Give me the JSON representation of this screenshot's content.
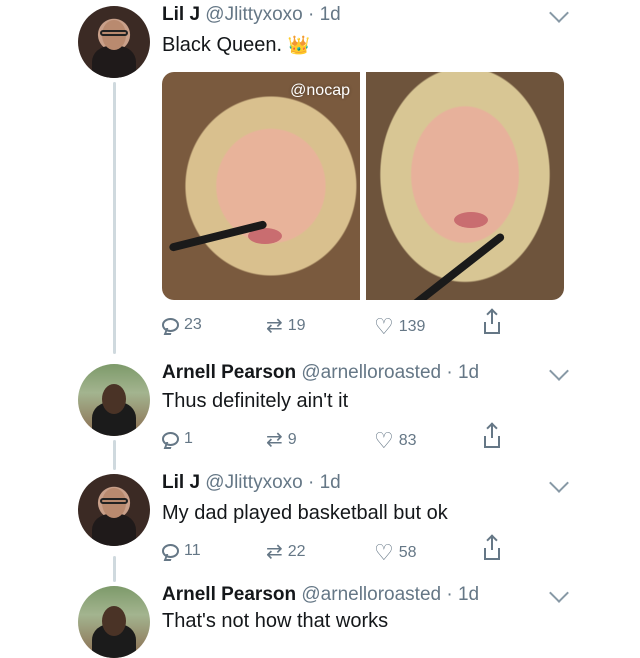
{
  "tweets": [
    {
      "name": "Lil J",
      "handle": "@Jlittyxoxo · 1d",
      "text": "Black Queen.",
      "emoji": "👑",
      "watermark": "@nocap",
      "replies": "23",
      "retweets": "19",
      "likes": "139"
    },
    {
      "name": "Arnell Pearson",
      "handle": "@arnelloroasted · 1d",
      "text": "Thus definitely ain't it",
      "replies": "1",
      "retweets": "9",
      "likes": "83"
    },
    {
      "name": "Lil J",
      "handle": "@Jlittyxoxo · 1d",
      "text": "My dad played basketball but ok",
      "replies": "11",
      "retweets": "22",
      "likes": "58"
    },
    {
      "name": "Arnell Pearson",
      "handle": "@arnelloroasted · 1d",
      "text": "That's not how that works"
    }
  ],
  "icons": {
    "reply": "reply-icon",
    "retweet": "retweet-icon",
    "like": "heart-icon",
    "share": "share-icon",
    "menu": "chevron-down-icon"
  },
  "colors": {
    "text": "#14171a",
    "secondary": "#657786",
    "thread_line": "#cfd9de"
  }
}
